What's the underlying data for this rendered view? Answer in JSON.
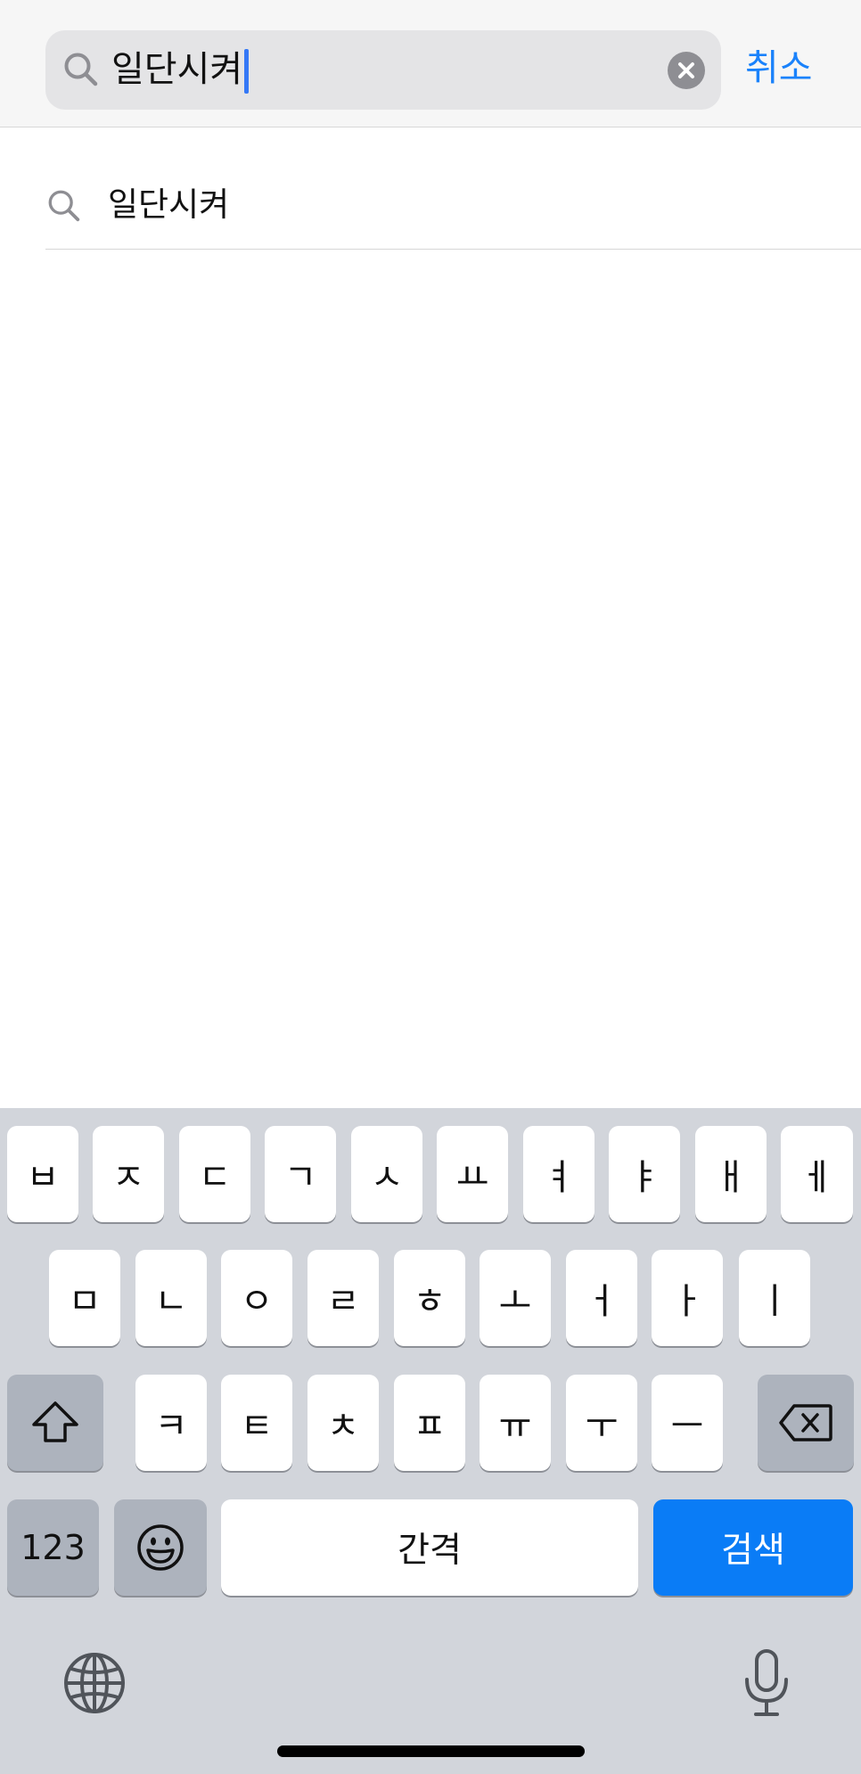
{
  "search": {
    "query": "일단시켜",
    "cancel_label": "취소"
  },
  "suggestions": [
    {
      "text": "일단시켜"
    }
  ],
  "keyboard": {
    "row1": [
      "ㅂ",
      "ㅈ",
      "ㄷ",
      "ㄱ",
      "ㅅ",
      "ㅛ",
      "ㅕ",
      "ㅑ",
      "ㅐ",
      "ㅔ"
    ],
    "row2": [
      "ㅁ",
      "ㄴ",
      "ㅇ",
      "ㄹ",
      "ㅎ",
      "ㅗ",
      "ㅓ",
      "ㅏ",
      "ㅣ"
    ],
    "row3": [
      "ㅋ",
      "ㅌ",
      "ㅊ",
      "ㅍ",
      "ㅠ",
      "ㅜ",
      "ㅡ"
    ],
    "numbers_label": "123",
    "space_label": "간격",
    "search_label": "검색",
    "icons": {
      "shift": "shift-icon",
      "backspace": "backspace-icon",
      "emoji": "emoji-icon",
      "globe": "globe-icon",
      "mic": "microphone-icon"
    }
  },
  "colors": {
    "accent": "#1a82fb",
    "search_key": "#0a7cf6",
    "keyboard_bg": "#d2d5db"
  }
}
